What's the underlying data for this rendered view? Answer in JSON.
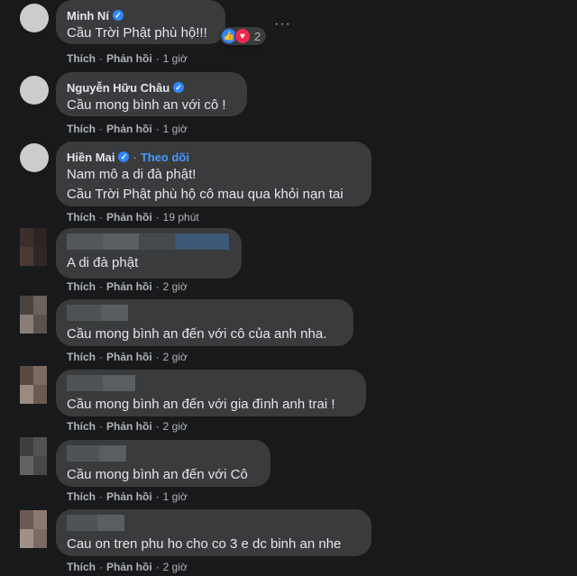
{
  "comments": [
    {
      "name": "Minh Ní",
      "lines": [
        "Cầu Trời Phật phù hộ!!!"
      ],
      "like": "Thích",
      "reply": "Phản hồi",
      "time": "1 giờ",
      "reactions": "2",
      "more": "···"
    },
    {
      "name": "Nguyễn Hữu Châu",
      "lines": [
        "Cầu mong bình an với cô !"
      ],
      "like": "Thích",
      "reply": "Phản hồi",
      "time": "1 giờ"
    },
    {
      "name": "Hiền Mai",
      "follow": "Theo dõi",
      "lines": [
        "Nam mô a di đà phật!",
        "Cầu Trời Phật phù hộ cô mau qua khỏi nạn tai"
      ],
      "like": "Thích",
      "reply": "Phản hồi",
      "time": "19 phút"
    },
    {
      "lines": [
        "A di đà phật"
      ],
      "like": "Thích",
      "reply": "Phản hồi",
      "time": "2 giờ"
    },
    {
      "lines": [
        "Cầu mong bình an đến với cô của anh nha."
      ],
      "like": "Thích",
      "reply": "Phản hồi",
      "time": "2 giờ"
    },
    {
      "lines": [
        "Cầu mong bình an đến với gia đình anh trai !"
      ],
      "like": "Thích",
      "reply": "Phản hồi",
      "time": "2 giờ"
    },
    {
      "lines": [
        "Cầu mong bình an đến với Cô"
      ],
      "like": "Thích",
      "reply": "Phản hồi",
      "time": "1 giờ"
    },
    {
      "lines": [
        "Cau on tren phu ho cho co 3 e dc binh an nhe"
      ],
      "like": "Thích",
      "reply": "Phản hồi",
      "time": "2 giờ"
    }
  ],
  "icons": {
    "verified": "verified-badge-icon",
    "like_reaction": "like-reaction-icon",
    "love_reaction": "love-reaction-icon",
    "more": "more-options-icon"
  },
  "colors": {
    "background": "#18191a",
    "bubble": "#3a3b3c",
    "text": "#e4e6eb",
    "secondary": "#b0b3b8",
    "accent": "#2d88ff"
  }
}
